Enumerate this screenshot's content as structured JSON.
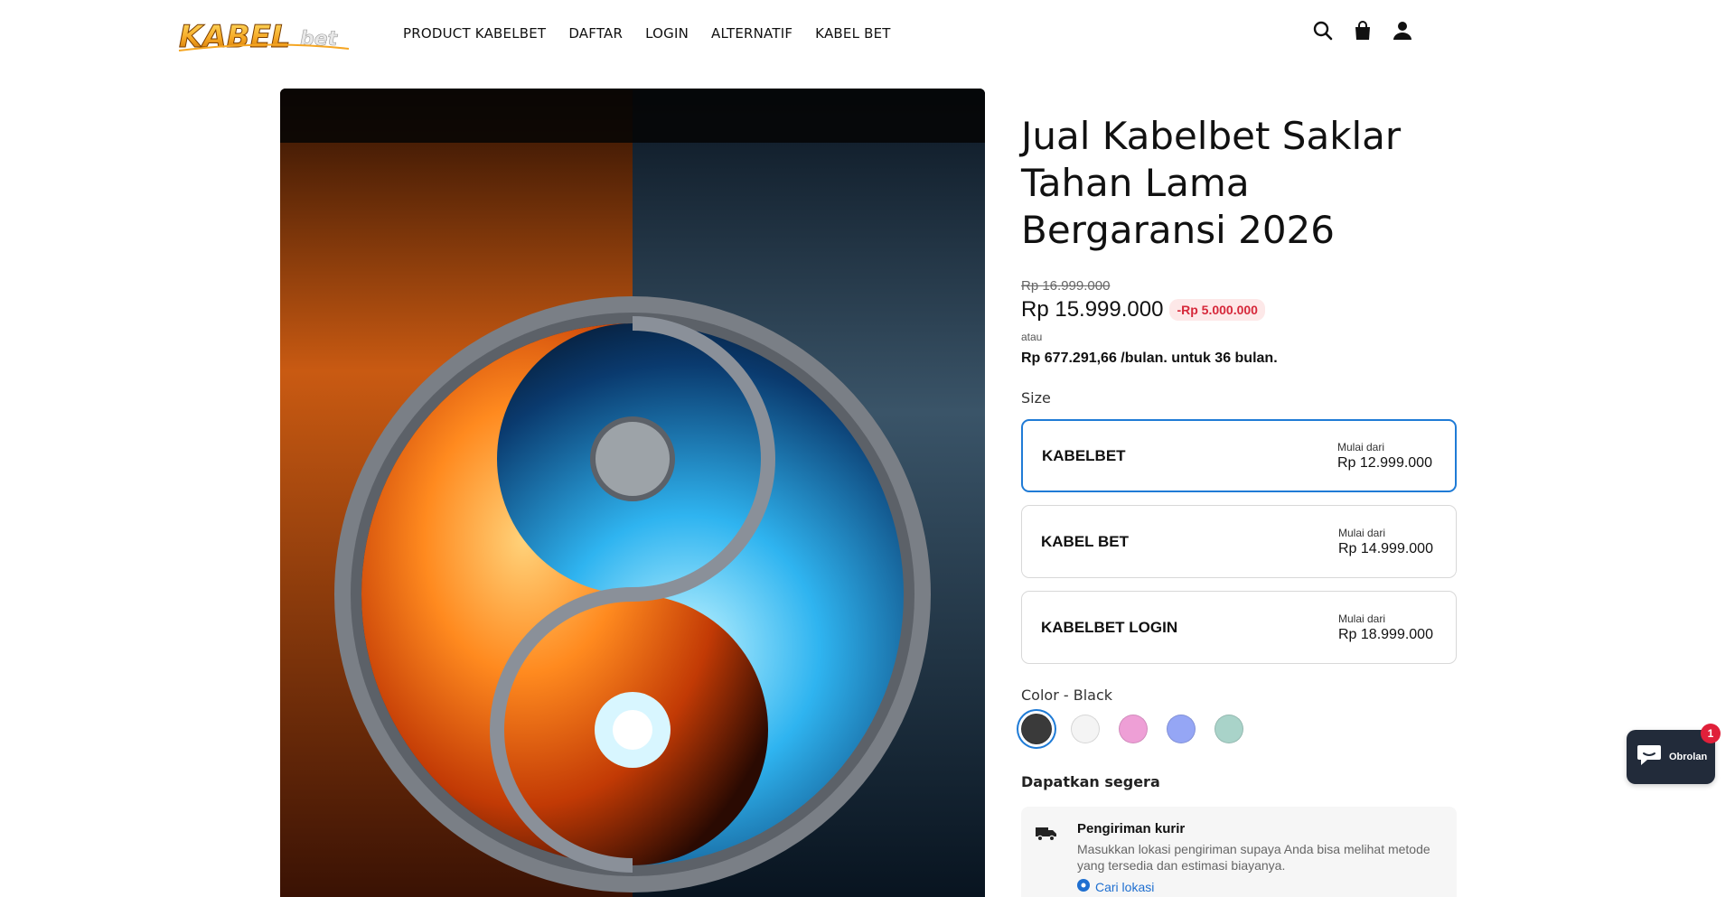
{
  "header": {
    "logo_text": "KABELBET",
    "nav": [
      "PRODUCT KABELBET",
      "DAFTAR",
      "LOGIN",
      "ALTERNATIF",
      "KABEL BET"
    ],
    "icons": [
      "search-icon",
      "cart-bag-icon",
      "account-icon"
    ]
  },
  "product": {
    "image_alt": "yin-yang fire and ice",
    "title": "Jual Kabelbet Saklar Tahan Lama Bergaransi 2026",
    "compare_price": "Rp 16.999.000",
    "price": "Rp 15.999.000",
    "discount": "-Rp 5.000.000",
    "or_label": "atau",
    "installment": "Rp 677.291,66 /bulan. untuk 36 bulan."
  },
  "size": {
    "label": "Size",
    "selected_index": 0,
    "options": [
      {
        "name": "KABELBET",
        "from": "Mulai dari",
        "price": "Rp 12.999.000"
      },
      {
        "name": "KABEL BET",
        "from": "Mulai dari",
        "price": "Rp 14.999.000"
      },
      {
        "name": "KABELBET LOGIN",
        "from": "Mulai dari",
        "price": "Rp 18.999.000"
      }
    ]
  },
  "color": {
    "label": "Color - Black",
    "selected_index": 0,
    "swatches": [
      {
        "name": "Black",
        "hex": "#3a3a3a"
      },
      {
        "name": "White",
        "hex": "#f4f4f4"
      },
      {
        "name": "Pink",
        "hex": "#ee9fd6"
      },
      {
        "name": "Periwinkle",
        "hex": "#95a6f5"
      },
      {
        "name": "Mint",
        "hex": "#a9d3c9"
      }
    ]
  },
  "delivery": {
    "heading": "Dapatkan segera",
    "title": "Pengiriman kurir",
    "description": "Masukkan lokasi pengiriman supaya Anda bisa melihat metode yang tersedia dan estimasi biayanya.",
    "find_location": "Cari lokasi"
  },
  "chat": {
    "label": "Obrolan",
    "badge": "1"
  },
  "colors": {
    "accent": "#1f7bd6",
    "discount_bg": "#fde8e8",
    "discount_text": "#d6283a",
    "chat_bg": "#222b3a"
  }
}
